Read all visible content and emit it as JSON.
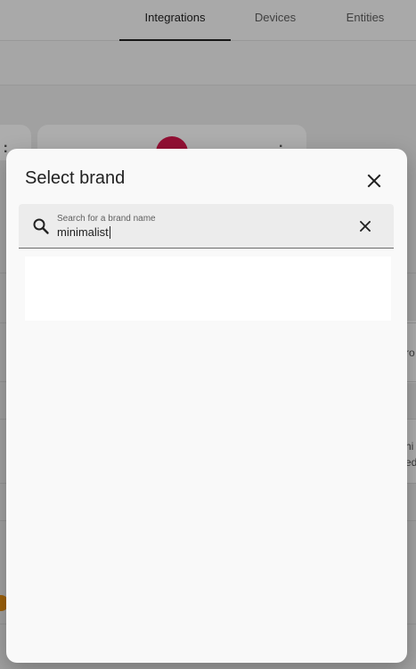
{
  "background": {
    "tabs": [
      {
        "label": "Integrations",
        "active": true
      },
      {
        "label": "Devices",
        "active": false
      },
      {
        "label": "Entities",
        "active": false
      }
    ],
    "edge_texts": [
      "ro",
      "hi",
      "ed"
    ]
  },
  "dialog": {
    "title": "Select brand",
    "search": {
      "label": "Search for a brand name",
      "value": "minimalist"
    },
    "icons": {
      "close": "close-icon",
      "search": "search-icon",
      "clear": "clear-icon"
    }
  },
  "colors": {
    "accent_logo": "#d8194d",
    "badge_orange": "#e8900f"
  }
}
